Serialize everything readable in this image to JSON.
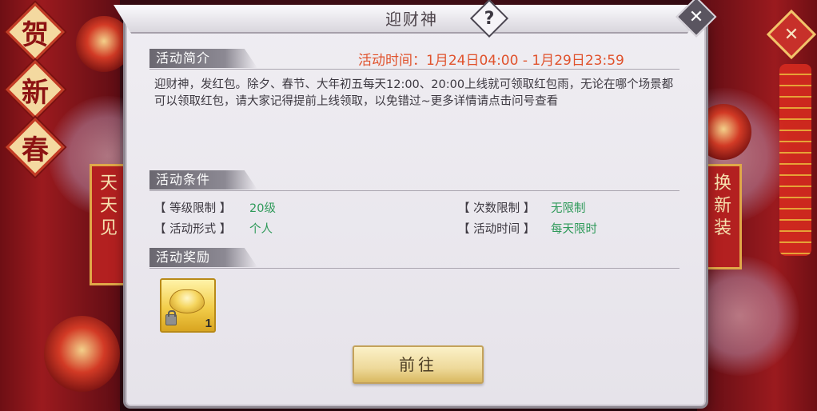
{
  "background": {
    "left_chars": [
      "贺",
      "新",
      "春"
    ],
    "left_banner_chars": "天天见",
    "right_banner_chars": "换新装"
  },
  "dialog": {
    "title": "迎财神",
    "help_icon": "?",
    "close_icon": "✕",
    "outer_close_icon": "✕",
    "intro": {
      "header": "活动简介",
      "time_label": "活动时间：1月24日04:00 - 1月29日23:59",
      "description": "迎财神，发红包。除夕、春节、大年初五每天12:00、20:00上线就可领取红包雨，无论在哪个场景都可以领取红包，请大家记得提前上线领取，以免错过~更多详情请点击问号查看"
    },
    "conditions": {
      "header": "活动条件",
      "level_label": "【 等级限制 】",
      "level_value": "20级",
      "count_label": "【 次数限制 】",
      "count_value": "无限制",
      "form_label": "【 活动形式 】",
      "form_value": "个人",
      "time_label": "【 活动时间 】",
      "time_value": "每天限时"
    },
    "rewards": {
      "header": "活动奖励",
      "items": [
        {
          "icon": "gold-ingot-icon",
          "count": "1"
        }
      ]
    },
    "go_button": "前往"
  },
  "colors": {
    "time_text": "#e0522c",
    "condition_value": "#2f9a5a",
    "button_gold": "#eed99a"
  }
}
